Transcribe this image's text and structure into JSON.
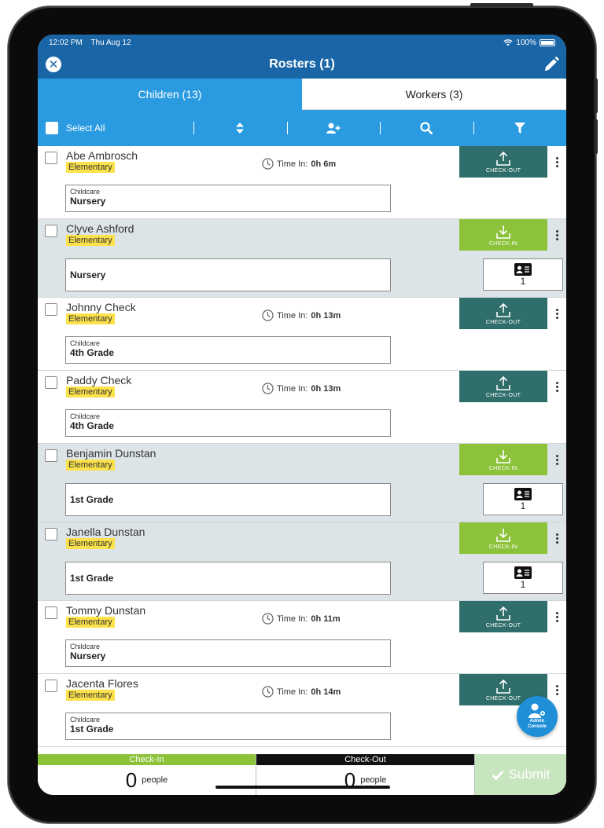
{
  "status": {
    "time": "12:02 PM",
    "date": "Thu Aug 12",
    "battery": "100%"
  },
  "nav": {
    "title": "Rosters (1)"
  },
  "tabs": [
    {
      "label": "Children (13)"
    },
    {
      "label": "Workers (3)"
    }
  ],
  "toolbar": {
    "select_all": "Select All"
  },
  "labels": {
    "check_out": "CHECK-OUT",
    "check_in": "CHECK-IN",
    "time_in": "Time In:"
  },
  "children": [
    {
      "name": "Abe Ambrosch",
      "group": "Elementary",
      "state": "checkout",
      "time": "0h 6m",
      "room_type": "Childcare",
      "room": "Nursery"
    },
    {
      "name": "Clyve Ashford",
      "group": "Elementary",
      "state": "checkin",
      "room": "Nursery",
      "tags": "1"
    },
    {
      "name": "Johnny Check",
      "group": "Elementary",
      "state": "checkout",
      "time": "0h 13m",
      "room_type": "Childcare",
      "room": "4th Grade"
    },
    {
      "name": "Paddy Check",
      "group": "Elementary",
      "state": "checkout",
      "time": "0h 13m",
      "room_type": "Childcare",
      "room": "4th Grade"
    },
    {
      "name": "Benjamin Dunstan",
      "group": "Elementary",
      "state": "checkin",
      "room": "1st Grade",
      "tags": "1"
    },
    {
      "name": "Janella Dunstan",
      "group": "Elementary",
      "state": "checkin",
      "room": "1st Grade",
      "tags": "1"
    },
    {
      "name": "Tommy Dunstan",
      "group": "Elementary",
      "state": "checkout",
      "time": "0h 11m",
      "room_type": "Childcare",
      "room": "Nursery"
    },
    {
      "name": "Jacenta Flores",
      "group": "Elementary",
      "state": "checkout",
      "time": "0h 14m",
      "room_type": "Childcare",
      "room": "1st Grade"
    }
  ],
  "admin": {
    "line1": "Admin",
    "line2": "Console"
  },
  "footer": {
    "checkin_label": "Check-In",
    "checkin_count": "0",
    "checkout_label": "Check-Out",
    "checkout_count": "0",
    "unit": "people",
    "submit": "Submit"
  },
  "colors": {
    "navy": "#1a65a6",
    "sky": "#2b9be1",
    "checkout": "#2f6e6a",
    "checkin": "#8cc33a",
    "badge": "#fbe14a"
  }
}
